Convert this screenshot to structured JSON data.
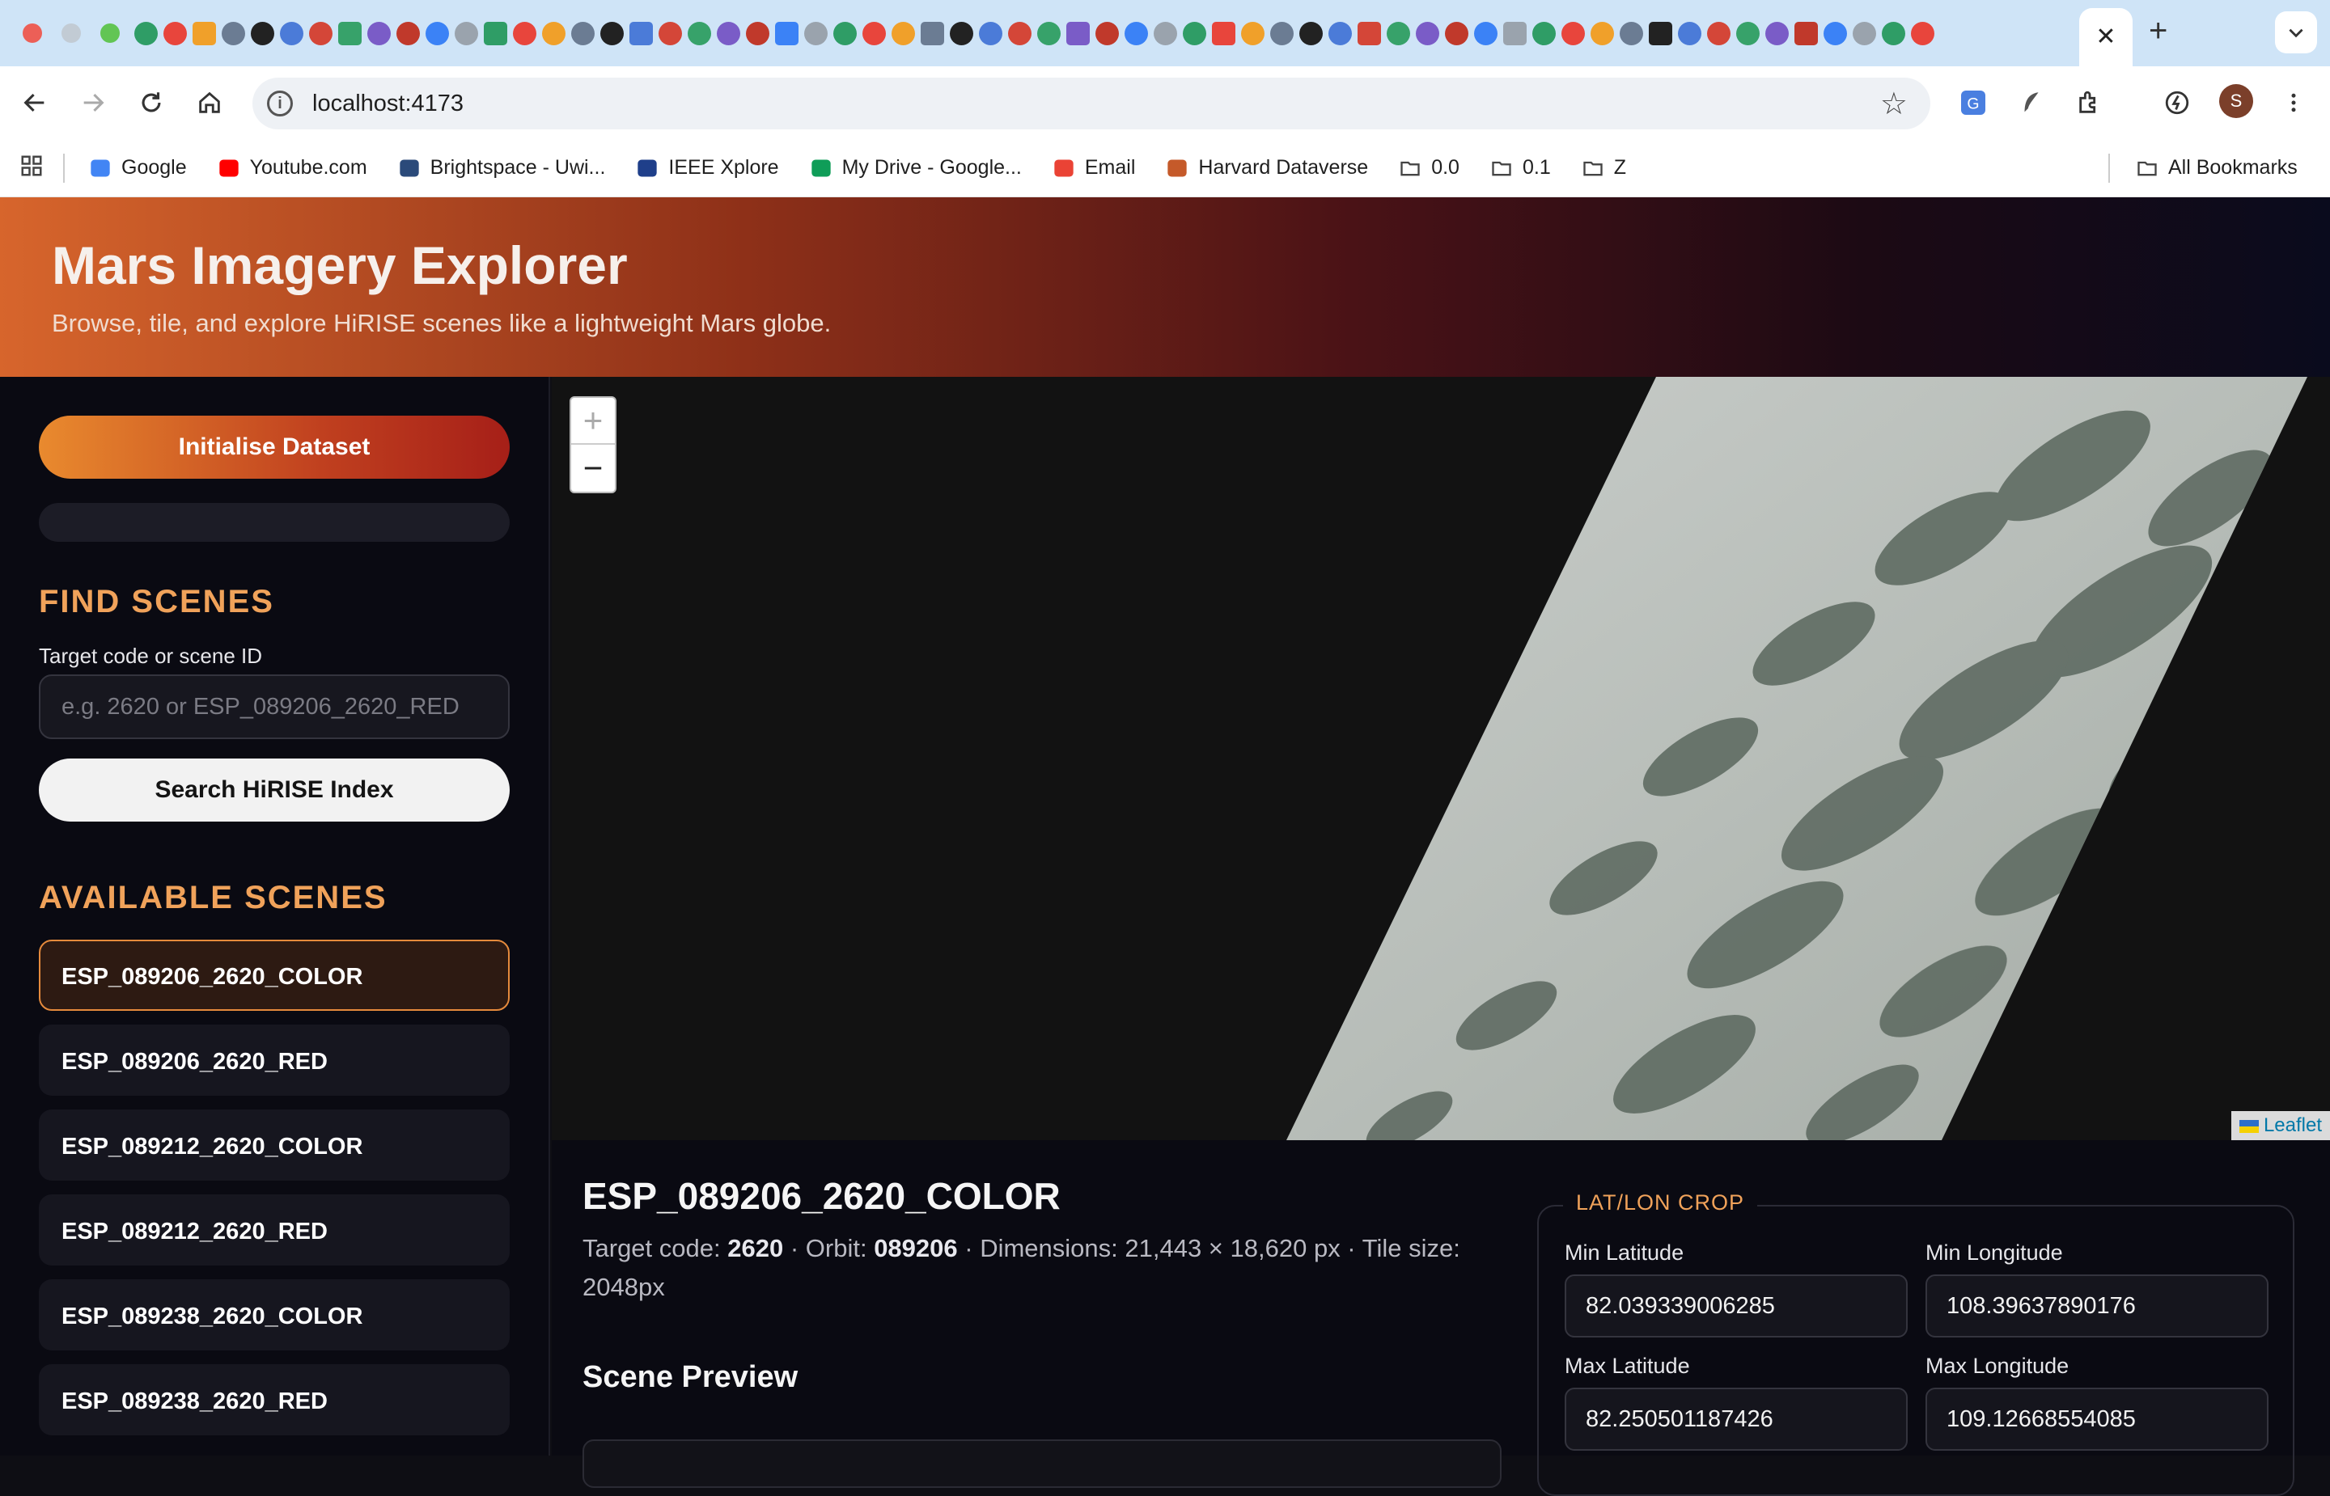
{
  "browser": {
    "url": "localhost:4173",
    "bookmarks": [
      {
        "label": "Google",
        "icon": "google-icon",
        "color": "#4285f4"
      },
      {
        "label": "Youtube.com",
        "icon": "youtube-icon",
        "color": "#ff0000"
      },
      {
        "label": "Brightspace - Uwi...",
        "icon": "brightspace-icon",
        "color": "#2b4a7a"
      },
      {
        "label": "IEEE Xplore",
        "icon": "ieee-icon",
        "color": "#1f3f8a"
      },
      {
        "label": "My Drive - Google...",
        "icon": "drive-icon",
        "color": "#0f9d58"
      },
      {
        "label": "Email",
        "icon": "gmail-icon",
        "color": "#ea4335"
      },
      {
        "label": "Harvard Dataverse",
        "icon": "dataverse-icon",
        "color": "#c55a2a"
      },
      {
        "label": "0.0",
        "icon": "folder-icon",
        "color": "#444444"
      },
      {
        "label": "0.1",
        "icon": "folder-icon",
        "color": "#444444"
      },
      {
        "label": "Z",
        "icon": "folder-icon",
        "color": "#444444"
      }
    ],
    "all_bookmarks": "All Bookmarks",
    "profile_initial": "S"
  },
  "app": {
    "title": "Mars Imagery Explorer",
    "subtitle": "Browse, tile, and explore HiRISE scenes like a lightweight Mars globe."
  },
  "sidebar": {
    "init_button": "Initialise Dataset",
    "find_title": "FIND SCENES",
    "search_label": "Target code or scene ID",
    "search_placeholder": "e.g. 2620 or ESP_089206_2620_RED",
    "search_button": "Search HiRISE Index",
    "available_title": "AVAILABLE SCENES",
    "scenes": [
      {
        "label": "ESP_089206_2620_COLOR",
        "active": true
      },
      {
        "label": "ESP_089206_2620_RED",
        "active": false
      },
      {
        "label": "ESP_089212_2620_COLOR",
        "active": false
      },
      {
        "label": "ESP_089212_2620_RED",
        "active": false
      },
      {
        "label": "ESP_089238_2620_COLOR",
        "active": false
      },
      {
        "label": "ESP_089238_2620_RED",
        "active": false
      }
    ]
  },
  "map": {
    "zoom_in": "+",
    "zoom_out": "−",
    "attribution": "Leaflet"
  },
  "details": {
    "scene_name": "ESP_089206_2620_COLOR",
    "target_label": "Target code:",
    "target_value": "2620",
    "orbit_label": "Orbit:",
    "orbit_value": "089206",
    "dimensions": "Dimensions: 21,443 × 18,620 px · Tile size: 2048px",
    "preview_title": "Scene Preview"
  },
  "crop": {
    "legend": "LAT/LON CROP",
    "min_lat_label": "Min Latitude",
    "min_lat": "82.039339006285",
    "min_lon_label": "Min Longitude",
    "min_lon": "108.39637890176",
    "max_lat_label": "Max Latitude",
    "max_lat": "82.250501187426",
    "max_lon_label": "Max Longitude",
    "max_lon": "109.12668554085"
  },
  "colors": {
    "accent": "#f0a25a",
    "active_border": "#e58a3c"
  }
}
